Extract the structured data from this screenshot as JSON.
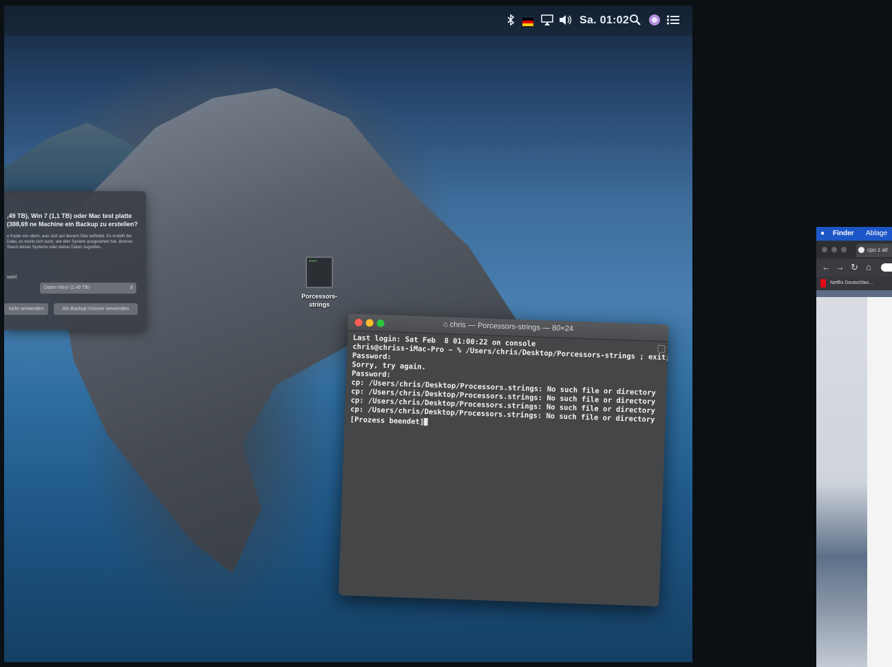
{
  "menubar": {
    "icons": [
      "bluetooth-icon",
      "german-flag-icon",
      "airplay-icon",
      "volume-icon"
    ],
    "time": "Sa. 01:02",
    "right_icons": [
      "spotlight-icon",
      "siri-icon",
      "notification-center-icon"
    ]
  },
  "timemachine_dialog": {
    "title": ",49 TB), Win 7 (1,1 TB) oder Mac test platte (388,69 ne Machine ein Backup zu erstellen?",
    "body": "e Kopie von allem, was sich auf deinem Mac befindet. Es erstellt der Datei, es merkt sich auch, wie dein System ausgesehen hat. ähreren Stand deines Systems oder deiner Daten zugreifen.",
    "select_label": "wahl",
    "select_value": "Daten Neu! (2,49 TB)",
    "btn_left": "nicht verwenden",
    "btn_right": "Als Backup-Volume verwenden"
  },
  "desktop_icon": {
    "badge": "exec",
    "label": "Porcessors-strings"
  },
  "terminal": {
    "title": "chris — Porcessors-strings — 80×24",
    "lines": [
      "Last login: Sat Feb  8 01:00:22 on console",
      "chris@chriss-iMac-Pro ~ % /Users/chris/Desktop/Porcessors-strings ; exit;",
      "Password:",
      "Sorry, try again.",
      "Password:",
      "cp: /Users/chris/Desktop/Processors.strings: No such file or directory",
      "cp: /Users/chris/Desktop/Processors.strings: No such file or directory",
      "cp: /Users/chris/Desktop/Processors.strings: No such file or directory",
      "cp: /Users/chris/Desktop/Processors.strings: No such file or directory"
    ],
    "end_line": "[Prozess beendet]"
  },
  "second_monitor": {
    "menubar_finder": "Finder",
    "menubar_ablage": "Ablage",
    "tab_label": "cpu z alt",
    "bookmark": "Netflix Deutschlan..."
  },
  "colors": {
    "close": "#ff5f57",
    "minimize": "#febc2e",
    "maximize": "#28c840",
    "finder_bar": "#1d57c7"
  }
}
